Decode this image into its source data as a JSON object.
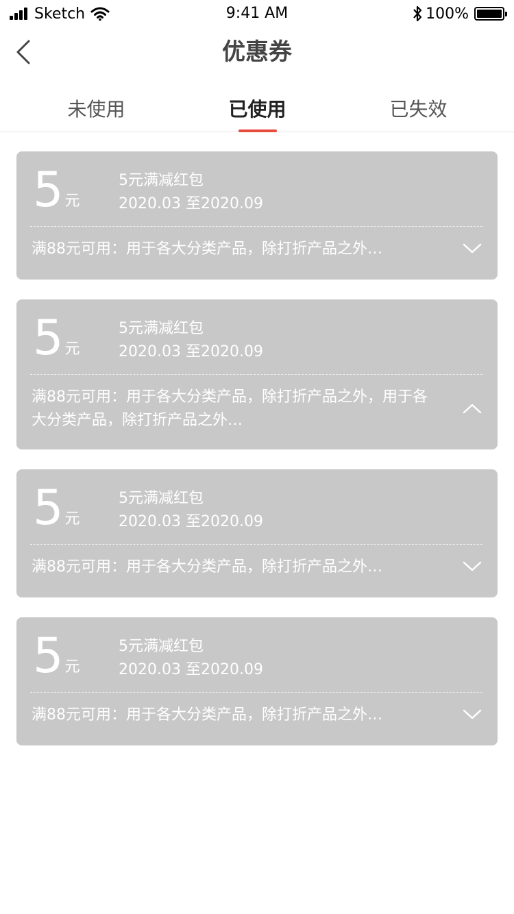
{
  "status_bar": {
    "carrier": "Sketch",
    "time": "9:41 AM",
    "battery": "100%"
  },
  "nav": {
    "title": "优惠券",
    "back_icon": "chevron-left-icon"
  },
  "tabs": [
    {
      "label": "未使用",
      "active": false
    },
    {
      "label": "已使用",
      "active": true
    },
    {
      "label": "已失效",
      "active": false
    }
  ],
  "colors": {
    "accent": "#e84a3c",
    "card": "#c8c8c8"
  },
  "coupons": [
    {
      "amount": "5",
      "unit": "元",
      "name": "5元满减红包",
      "date": "2020.03 至2020.09",
      "desc": "满88元可用：用于各大分类产品，除打折产品之外…",
      "expanded": false
    },
    {
      "amount": "5",
      "unit": "元",
      "name": "5元满减红包",
      "date": "2020.03 至2020.09",
      "desc": "满88元可用：用于各大分类产品，除打折产品之外，用于各大分类产品，除打折产品之外…",
      "expanded": true
    },
    {
      "amount": "5",
      "unit": "元",
      "name": "5元满减红包",
      "date": "2020.03 至2020.09",
      "desc": "满88元可用：用于各大分类产品，除打折产品之外…",
      "expanded": false
    },
    {
      "amount": "5",
      "unit": "元",
      "name": "5元满减红包",
      "date": "2020.03 至2020.09",
      "desc": "满88元可用：用于各大分类产品，除打折产品之外…",
      "expanded": false
    }
  ]
}
